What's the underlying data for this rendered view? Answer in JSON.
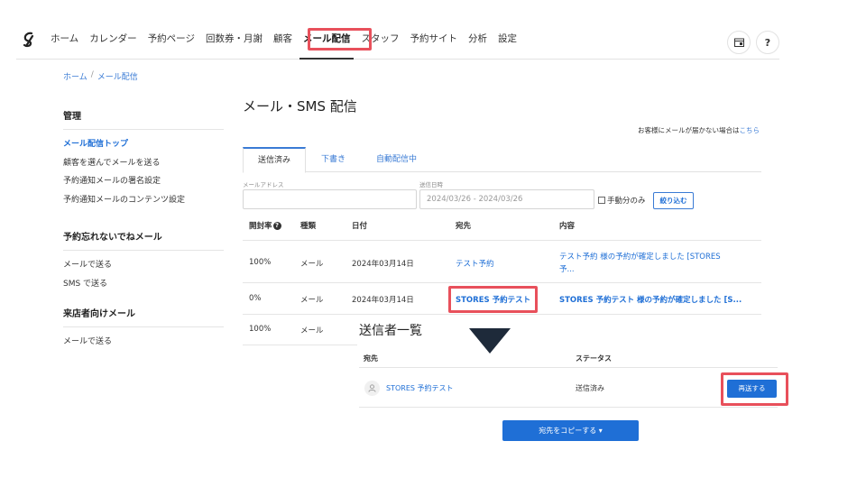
{
  "nav": {
    "items": [
      "ホーム",
      "カレンダー",
      "予約ページ",
      "回数券・月謝",
      "顧客",
      "メール配信",
      "スタッフ",
      "予約サイト",
      "分析",
      "設定"
    ],
    "active_index": 5,
    "help_label": "?"
  },
  "breadcrumb": {
    "home": "ホーム",
    "sep": "/",
    "current": "メール配信"
  },
  "sidebar": {
    "groups": [
      {
        "heading": "管理",
        "links": [
          "メール配信トップ",
          "顧客を選んでメールを送る",
          "予約通知メールの署名設定",
          "予約通知メールのコンテンツ設定"
        ]
      },
      {
        "heading": "予約忘れないでねメール",
        "links": [
          "メールで送る",
          "SMS で送る"
        ]
      },
      {
        "heading": "来店者向けメール",
        "links": [
          "メールで送る"
        ]
      }
    ]
  },
  "main": {
    "title": "メール・SMS 配信",
    "help_text": "お客様にメールが届かない場合は",
    "help_link": "こちら",
    "tabs": [
      "送信済み",
      "下書き",
      "自動配信中"
    ],
    "filters": {
      "email_label": "メールアドレス",
      "email_placeholder": "",
      "date_label": "送信日時",
      "date_value": "2024/03/26 - 2024/03/26",
      "manual_only": "手動分のみ",
      "filter_button": "絞り込む"
    },
    "table": {
      "headers": [
        "開封率",
        "種類",
        "日付",
        "宛先",
        "内容"
      ],
      "rows": [
        {
          "open_rate": "100%",
          "type": "メール",
          "date": "2024年03月14日",
          "to": "テスト予約",
          "content_1": "テスト予約 様の予約が確定しました [STORES",
          "content_2": "予..."
        },
        {
          "open_rate": "0%",
          "type": "メール",
          "date": "2024年03月14日",
          "to": "STORES 予約テスト",
          "content_1": "STORES 予約テスト 様の予約が確定しました [S..."
        },
        {
          "open_rate": "100%",
          "type": "メール"
        }
      ]
    }
  },
  "senders": {
    "title": "送信者一覧",
    "headers": [
      "宛先",
      "ステータス"
    ],
    "row": {
      "name": "STORES 予約テスト",
      "status": "送信済み",
      "action": "再送する"
    },
    "copy_button": "宛先をコピーする ▾"
  },
  "colors": {
    "accent": "#1f6fd6",
    "highlight": "#e8505b",
    "arrow": "#1e2a3a"
  },
  "icons": [
    "logo-icon",
    "question-icon",
    "calendar-icon",
    "user-icon",
    "arrow-down-icon"
  ]
}
